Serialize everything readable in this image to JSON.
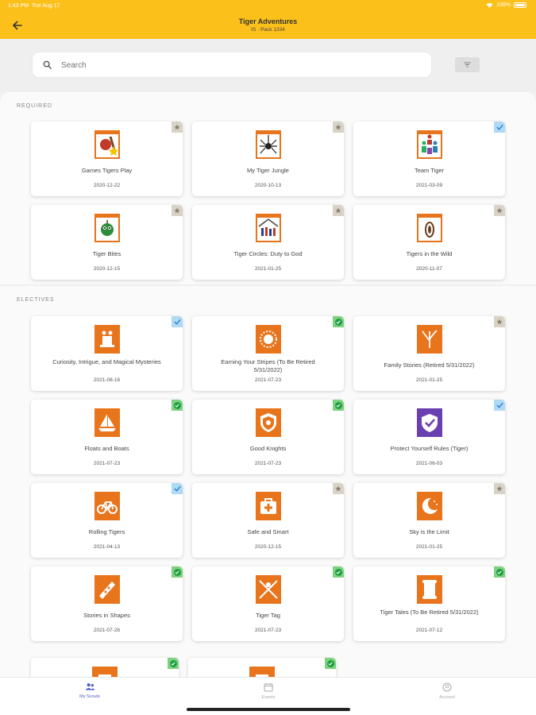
{
  "status": {
    "time": "1:43 PM",
    "date": "Tue Aug 17",
    "battery": "100%"
  },
  "header": {
    "title": "Tiger Adventures",
    "subtitle": "IS · Pack 1334"
  },
  "search": {
    "placeholder": "Search"
  },
  "required": {
    "label": "REQUIRED",
    "cards": [
      {
        "name": "Games Tigers Play",
        "date": "2020-12-22",
        "badge": "star",
        "icon": "baseball-icon"
      },
      {
        "name": "My Tiger Jungle",
        "date": "2020-10-13",
        "badge": "star",
        "icon": "spider-icon"
      },
      {
        "name": "Team Tiger",
        "date": "2021-03-09",
        "badge": "check",
        "icon": "team-icon"
      },
      {
        "name": "Tiger Bites",
        "date": "2020-12-15",
        "badge": "star",
        "icon": "apple-icon"
      },
      {
        "name": "Tiger Circles: Duty to God",
        "date": "2021-01-25",
        "badge": "star",
        "icon": "family-house-icon"
      },
      {
        "name": "Tigers in the Wild",
        "date": "2020-11-07",
        "badge": "star",
        "icon": "footprint-icon"
      }
    ]
  },
  "electives": {
    "label": "ELECTIVES",
    "cards": [
      {
        "name": "Curiosity, Intrigue, and Magical Mysteries",
        "date": "2021-08-16",
        "badge": "check",
        "icon": "magic-hat-icon"
      },
      {
        "name": "Earning Your Stripes (To Be Retired 5/31/2022)",
        "date": "2021-07-23",
        "badge": "done",
        "icon": "sun-face-icon"
      },
      {
        "name": "Family Stories (Retired 5/31/2022)",
        "date": "2021-01-25",
        "badge": "star",
        "icon": "tree-icon"
      },
      {
        "name": "Floats and Boats",
        "date": "2021-07-23",
        "badge": "done",
        "icon": "sailboat-icon"
      },
      {
        "name": "Good Knights",
        "date": "2021-07-23",
        "badge": "done",
        "icon": "shield-icon"
      },
      {
        "name": "Protect Yourself Rules (Tiger)",
        "date": "2021-06-03",
        "badge": "check",
        "icon": "purple-shield-icon"
      },
      {
        "name": "Rolling Tigers",
        "date": "2021-04-13",
        "badge": "check",
        "icon": "bicycle-icon"
      },
      {
        "name": "Safe and Smart",
        "date": "2020-12-15",
        "badge": "star",
        "icon": "first-aid-icon"
      },
      {
        "name": "Sky is the Limit",
        "date": "2021-01-25",
        "badge": "star",
        "icon": "moon-icon"
      },
      {
        "name": "Stories in Shapes",
        "date": "2021-07-26",
        "badge": "done",
        "icon": "palette-icon"
      },
      {
        "name": "Tiger Tag",
        "date": "2021-07-23",
        "badge": "done",
        "icon": "tag-game-icon"
      },
      {
        "name": "Tiger Tales (To Be Retired 5/31/2022)",
        "date": "2021-07-12",
        "badge": "done",
        "icon": "scroll-icon"
      },
      {
        "name": "",
        "date": "",
        "badge": "done",
        "icon": "partial-icon"
      },
      {
        "name": "",
        "date": "",
        "badge": "done",
        "icon": "partial-icon"
      }
    ]
  },
  "tabs": [
    {
      "label": "My Scouts",
      "icon": "scouts-icon",
      "active": true
    },
    {
      "label": "Events",
      "icon": "calendar-icon",
      "active": false
    },
    {
      "label": "Account",
      "icon": "account-icon",
      "active": false
    }
  ],
  "colors": {
    "header": "#fcc01b",
    "orange": "#e8741c",
    "active_tab": "#4a5bc3"
  }
}
